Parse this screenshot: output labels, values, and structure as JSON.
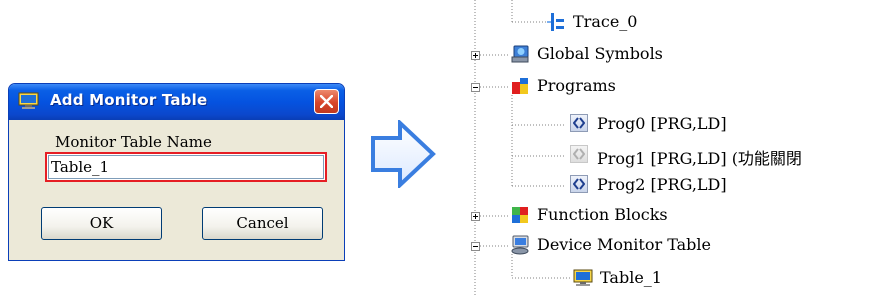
{
  "dialog": {
    "title": "Add Monitor Table",
    "field_label": "Monitor Table Name",
    "field_value": "Table_1",
    "ok_label": "OK",
    "cancel_label": "Cancel",
    "highlight_color": "#e61e24"
  },
  "tree": {
    "items": [
      {
        "label": "Trace_0",
        "icon": "trace-icon"
      },
      {
        "label": "Global Symbols",
        "icon": "global-symbols-icon",
        "expander": "plus"
      },
      {
        "label": "Programs",
        "icon": "programs-icon",
        "expander": "minus"
      },
      {
        "label": "Prog0 [PRG,LD]",
        "icon": "program-icon"
      },
      {
        "label": "Prog1 [PRG,LD] (功能關閉",
        "icon": "program-disabled-icon"
      },
      {
        "label": "Prog2 [PRG,LD]",
        "icon": "program-icon"
      },
      {
        "label": "Function Blocks",
        "icon": "function-blocks-icon",
        "expander": "plus"
      },
      {
        "label": "Device Monitor Table",
        "icon": "device-monitor-icon",
        "expander": "minus"
      },
      {
        "label": "Table_1",
        "icon": "monitor-table-icon"
      }
    ]
  },
  "colors": {
    "arrow_fill": "#f2f7ff",
    "arrow_stroke": "#3a7ee0",
    "title_bar": "#0553e0"
  }
}
